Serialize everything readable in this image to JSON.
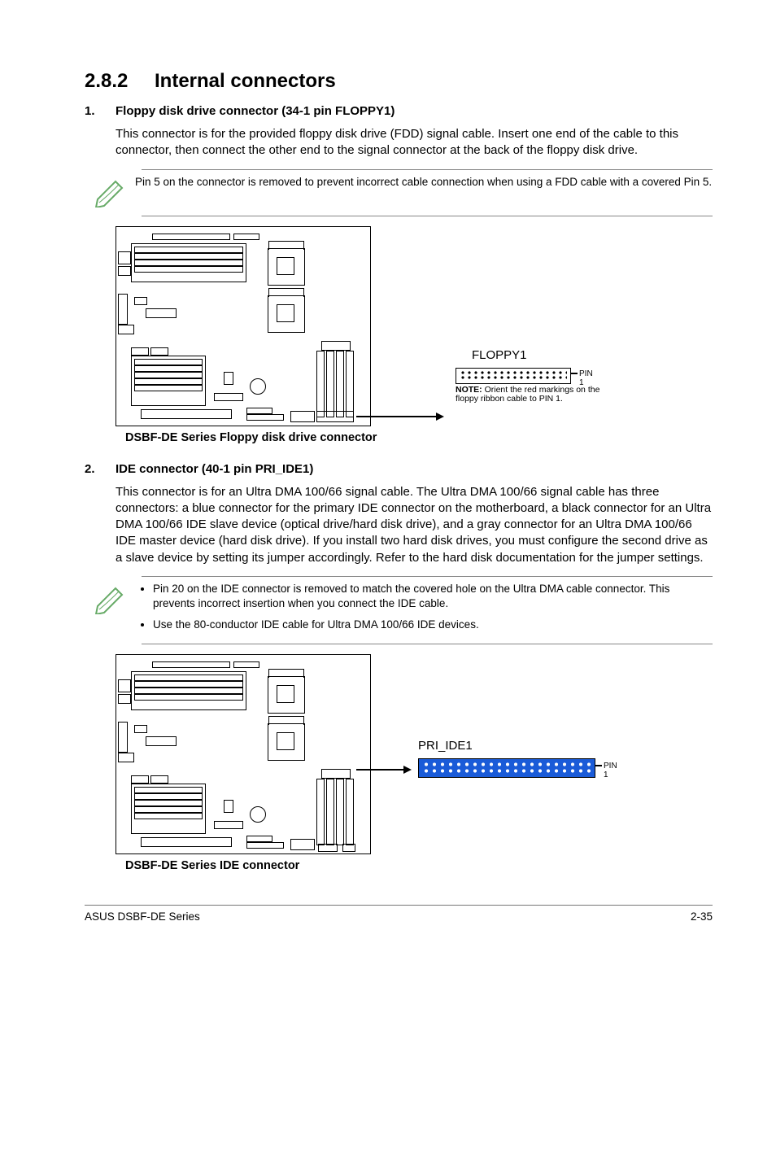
{
  "section": {
    "number": "2.8.2",
    "title": "Internal connectors"
  },
  "item1": {
    "num": "1.",
    "heading": "Floppy disk drive connector (34-1 pin FLOPPY1)",
    "body": "This connector is for the provided floppy disk drive (FDD) signal cable. Insert one end of the cable to this connector, then connect the other end to the signal connector at the back of the floppy disk drive.",
    "note": "Pin 5 on the connector is removed to prevent incorrect cable connection when using a FDD cable with a covered Pin 5.",
    "conn_label": "FLOPPY1",
    "pin1": "PIN 1",
    "conn_note_b": "NOTE:",
    "conn_note": "Orient the red markings on the floppy ribbon cable to PIN 1.",
    "caption": "DSBF-DE Series Floppy disk drive connector"
  },
  "item2": {
    "num": "2.",
    "heading": "IDE connector (40-1 pin PRI_IDE1)",
    "body": "This connector is for an Ultra DMA 100/66 signal cable. The Ultra DMA 100/66 signal cable has three connectors: a blue connector for the primary IDE connector on the motherboard, a black connector for an Ultra DMA 100/66 IDE slave device (optical drive/hard disk drive), and a gray connector for an Ultra DMA 100/66 IDE master device (hard disk drive). If you install two hard disk drives, you must configure the second drive as a slave device by setting its jumper accordingly. Refer to the hard disk documentation for the jumper settings.",
    "note_li1": "Pin 20 on the IDE connector is removed to match the covered hole on the Ultra DMA cable connector. This prevents incorrect insertion when you connect the IDE cable.",
    "note_li2": "Use the 80-conductor IDE cable for Ultra DMA 100/66 IDE devices.",
    "conn_label": "PRI_IDE1",
    "pin1": "PIN 1",
    "caption": "DSBF-DE Series IDE connector"
  },
  "footer": {
    "left": "ASUS DSBF-DE Series",
    "right": "2-35"
  }
}
